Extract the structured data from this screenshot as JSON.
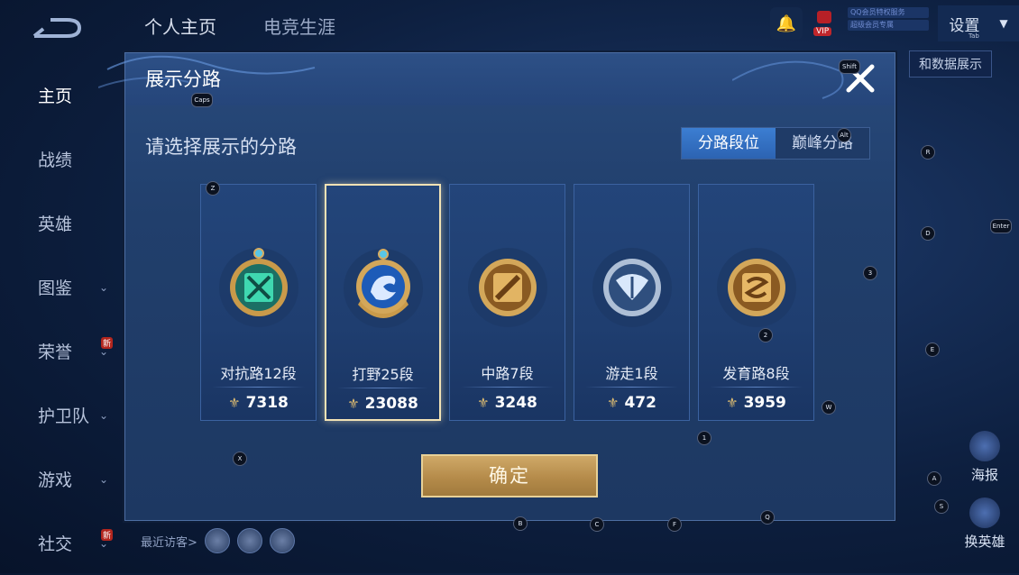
{
  "nav": {
    "tabs": [
      "个人主页",
      "电竞生涯"
    ],
    "settings_label": "设置",
    "settings_key": "Tab",
    "vip_label": "VIP",
    "promo_lines": [
      "QQ会员特权服务",
      "超级会员专属"
    ],
    "data_display_label": "和数据展示"
  },
  "sidebar": {
    "items": [
      {
        "label": "主页"
      },
      {
        "label": "战绩"
      },
      {
        "label": "英雄"
      },
      {
        "label": "图鉴"
      },
      {
        "label": "荣誉",
        "tag": "新"
      },
      {
        "label": "护卫队"
      },
      {
        "label": "游戏"
      },
      {
        "label": "社交",
        "tag": "新"
      }
    ]
  },
  "visitors": {
    "label": "最近访客>"
  },
  "right_actions": {
    "poster": "海报",
    "switch_hero": "换英雄"
  },
  "dialog": {
    "title": "展示分路",
    "prompt": "请选择展示的分路",
    "segments": [
      "分路段位",
      "巅峰分路"
    ],
    "active_segment": 0,
    "cards": [
      {
        "name": "对抗路12段",
        "score": "7318",
        "icon": "clash-lane-badge-icon",
        "color": "#3fd8b0"
      },
      {
        "name": "打野25段",
        "score": "23088",
        "icon": "jungle-badge-icon",
        "color": "#5aa7ff",
        "selected": true
      },
      {
        "name": "中路7段",
        "score": "3248",
        "icon": "mid-lane-badge-icon",
        "color": "#d8a04a"
      },
      {
        "name": "游走1段",
        "score": "472",
        "icon": "roam-badge-icon",
        "color": "#a9c9f2"
      },
      {
        "name": "发育路8段",
        "score": "3959",
        "icon": "farm-lane-badge-icon",
        "color": "#d89a4a"
      }
    ],
    "confirm_label": "确定"
  },
  "key_hints": [
    "Caps",
    "Shift",
    "Alt",
    "R",
    "Enter",
    "D",
    "3",
    "E",
    "2",
    "W",
    "1",
    "Z",
    "X",
    "B",
    "C",
    "F",
    "Q",
    "A",
    "S"
  ],
  "colors": {
    "accent": "#3c7ed2",
    "gold": "#cfa968",
    "panel": "#213f6c"
  }
}
